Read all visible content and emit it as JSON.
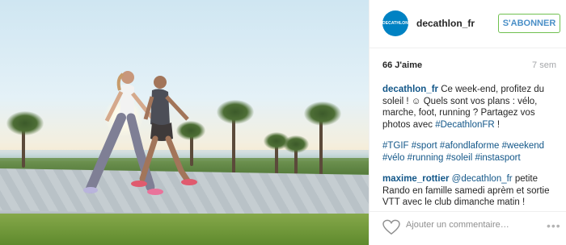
{
  "post": {
    "username": "decathlon_fr",
    "logo_text": "DECATHLON",
    "follow_label": "S'ABONNER",
    "likes": "66 J'aime",
    "age": "7 sem",
    "caption": {
      "author": "decathlon_fr",
      "text_1": "Ce week-end, profitez du soleil ! ",
      "emoji": "☺",
      "text_2": " Quels sont vos plans : vélo, marche, foot, running ? Partagez vos photos avec ",
      "mention": "#DecathlonFR",
      "text_3": " !"
    },
    "hashtags": "#TGIF #sport #afondlaforme #weekend #vélo #running #soleil #instasport",
    "comment": {
      "author": "maxime_rottier",
      "mention": "@decathlon_fr",
      "text": " petite Rando en famille samedi aprèm et sortie VTT avec le club dimanche matin !"
    },
    "add_comment_placeholder": "Ajouter un commentaire…",
    "more_label": "•••"
  },
  "colors": {
    "brand": "#0082c3",
    "link": "#125688",
    "follow_border": "#70c050"
  },
  "icons": {
    "like": "heart-icon",
    "more": "more-options-icon"
  }
}
